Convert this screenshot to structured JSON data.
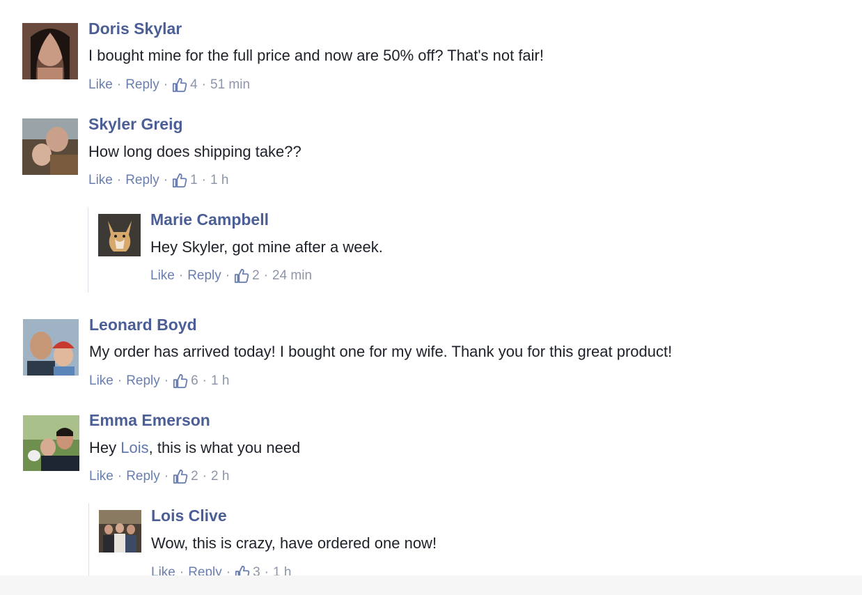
{
  "comments": [
    {
      "name": "Doris Skylar",
      "text": "I bought mine for the full price and now are 50% off? That's not fair!",
      "like_label": "Like",
      "reply_label": "Reply",
      "likes": "4",
      "time": "51 min",
      "avatar_icon": "user-avatar-photo"
    },
    {
      "name": "Skyler Greig",
      "text": "How long does shipping take??",
      "like_label": "Like",
      "reply_label": "Reply",
      "likes": "1",
      "time": "1 h",
      "avatar_icon": "user-avatar-photo"
    },
    {
      "name": "Marie Campbell",
      "text": "Hey Skyler, got mine after a week.",
      "like_label": "Like",
      "reply_label": "Reply",
      "likes": "2",
      "time": "24 min",
      "avatar_icon": "dog-avatar-photo"
    },
    {
      "name": "Leonard Boyd",
      "text": "My order has arrived today! I bought one for my wife. Thank you for this great product!",
      "like_label": "Like",
      "reply_label": "Reply",
      "likes": "6",
      "time": "1 h",
      "avatar_icon": "user-avatar-photo"
    },
    {
      "name": "Emma Emerson",
      "text_prefix": "Hey ",
      "mention": "Lois",
      "text_suffix": ", this is what you need",
      "like_label": "Like",
      "reply_label": "Reply",
      "likes": "2",
      "time": "2 h",
      "avatar_icon": "user-avatar-photo"
    },
    {
      "name": "Lois Clive",
      "text": "Wow, this is crazy, have ordered one now!",
      "like_label": "Like",
      "reply_label": "Reply",
      "likes": "3",
      "time": "1 h",
      "avatar_icon": "group-avatar-photo"
    }
  ],
  "colors": {
    "name": "#4b5f96",
    "link": "#6a7fb0",
    "meta": "#8d95a8",
    "text": "#1d2129"
  }
}
